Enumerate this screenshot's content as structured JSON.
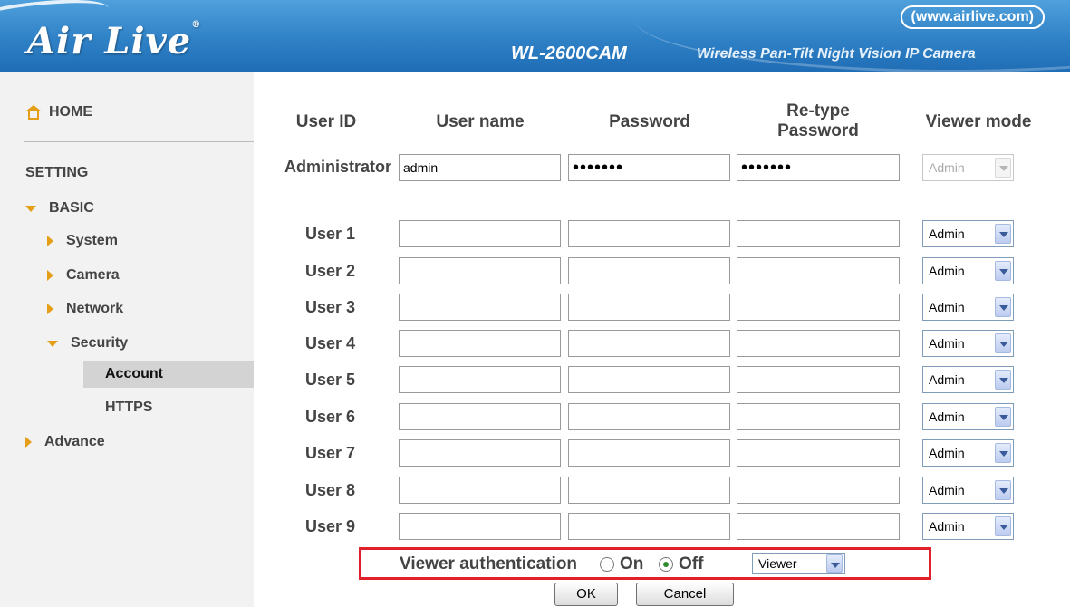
{
  "header": {
    "logo_text": "Air Live",
    "logo_mark": "®",
    "url_badge": "(www.airlive.com)",
    "model": "WL-2600CAM",
    "tagline": "Wireless Pan-Tilt Night Vision IP Camera"
  },
  "sidebar": {
    "home": "HOME",
    "setting": "SETTING",
    "basic": "BASIC",
    "system": "System",
    "camera": "Camera",
    "network": "Network",
    "security": "Security",
    "account": "Account",
    "https": "HTTPS",
    "advance": "Advance"
  },
  "columns": {
    "user_id": "User ID",
    "user_name": "User name",
    "password": "Password",
    "retype_line1": "Re-type",
    "retype_line2": "Password",
    "viewer_mode": "Viewer mode"
  },
  "admin_row": {
    "label": "Administrator",
    "username": "admin",
    "password": "•••••••",
    "retype": "•••••••",
    "mode": "Admin"
  },
  "users": [
    {
      "label": "User 1",
      "mode": "Admin"
    },
    {
      "label": "User 2",
      "mode": "Admin"
    },
    {
      "label": "User 3",
      "mode": "Admin"
    },
    {
      "label": "User 4",
      "mode": "Admin"
    },
    {
      "label": "User 5",
      "mode": "Admin"
    },
    {
      "label": "User 6",
      "mode": "Admin"
    },
    {
      "label": "User 7",
      "mode": "Admin"
    },
    {
      "label": "User 8",
      "mode": "Admin"
    },
    {
      "label": "User 9",
      "mode": "Admin"
    }
  ],
  "viewer_auth": {
    "label": "Viewer authentication",
    "on": "On",
    "off": "Off",
    "selected": "Off",
    "mode": "Viewer"
  },
  "buttons": {
    "ok": "OK",
    "cancel": "Cancel"
  },
  "colors": {
    "header_blue": "#2f81c6",
    "accent_orange": "#e59e17",
    "highlight_red": "#e0202a",
    "selected_nav": "#d3d3d3"
  }
}
